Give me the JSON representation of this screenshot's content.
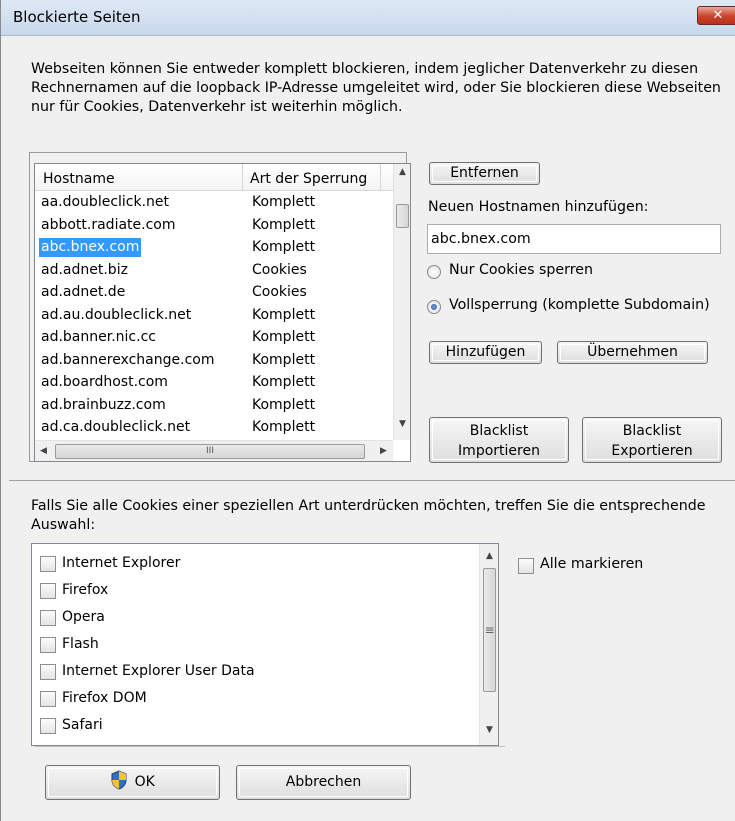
{
  "window": {
    "title": "Blockierte Seiten",
    "close_glyph": "✕"
  },
  "description": "Webseiten können Sie entweder komplett blockieren, indem jeglicher Datenverkehr zu diesen Rechnernamen auf die loopback IP-Adresse umgeleitet wird, oder Sie blockieren diese Webseiten nur für Cookies, Datenverkehr ist weiterhin möglich.",
  "hosts": {
    "columns": [
      "Hostname",
      "Art der Sperrung"
    ],
    "rows": [
      {
        "host": "aa.doubleclick.net",
        "mode": "Komplett"
      },
      {
        "host": "abbott.radiate.com",
        "mode": "Komplett"
      },
      {
        "host": "abc.bnex.com",
        "mode": "Komplett",
        "selected": true
      },
      {
        "host": "ad.adnet.biz",
        "mode": "Cookies"
      },
      {
        "host": "ad.adnet.de",
        "mode": "Cookies"
      },
      {
        "host": "ad.au.doubleclick.net",
        "mode": "Komplett"
      },
      {
        "host": "ad.banner.nic.cc",
        "mode": "Komplett"
      },
      {
        "host": "ad.bannerexchange.com",
        "mode": "Komplett"
      },
      {
        "host": "ad.boardhost.com",
        "mode": "Komplett"
      },
      {
        "host": "ad.brainbuzz.com",
        "mode": "Komplett"
      },
      {
        "host": "ad.ca.doubleclick.net",
        "mode": "Komplett"
      }
    ],
    "hscroll_grip": "III"
  },
  "buttons": {
    "remove": "Entfernen",
    "add": "Hinzufügen",
    "apply": "Übernehmen",
    "import_line1": "Blacklist",
    "import_line2": "Importieren",
    "export_line1": "Blacklist",
    "export_line2": "Exportieren",
    "ok": "OK",
    "cancel": "Abbrechen"
  },
  "new_host": {
    "label": "Neuen Hostnamen hinzufügen:",
    "value": "abc.bnex.com"
  },
  "options": {
    "cookies_only": "Nur Cookies sperren",
    "full_block": "Vollsperrung (komplette Subdomain)",
    "selected": "full_block"
  },
  "cookies_section": {
    "description": "Falls Sie alle Cookies einer speziellen Art unterdrücken möchten, treffen Sie die entsprechende Auswahl:",
    "select_all": "Alle markieren",
    "items": [
      "Internet Explorer",
      "Firefox",
      "Opera",
      "Flash",
      "Internet Explorer User Data",
      "Firefox DOM",
      "Safari"
    ],
    "scroll_grip": "≡"
  },
  "colors": {
    "selection": "#3399ff",
    "shield_blue": "#2f6fc9",
    "shield_yellow": "#f2c230"
  }
}
